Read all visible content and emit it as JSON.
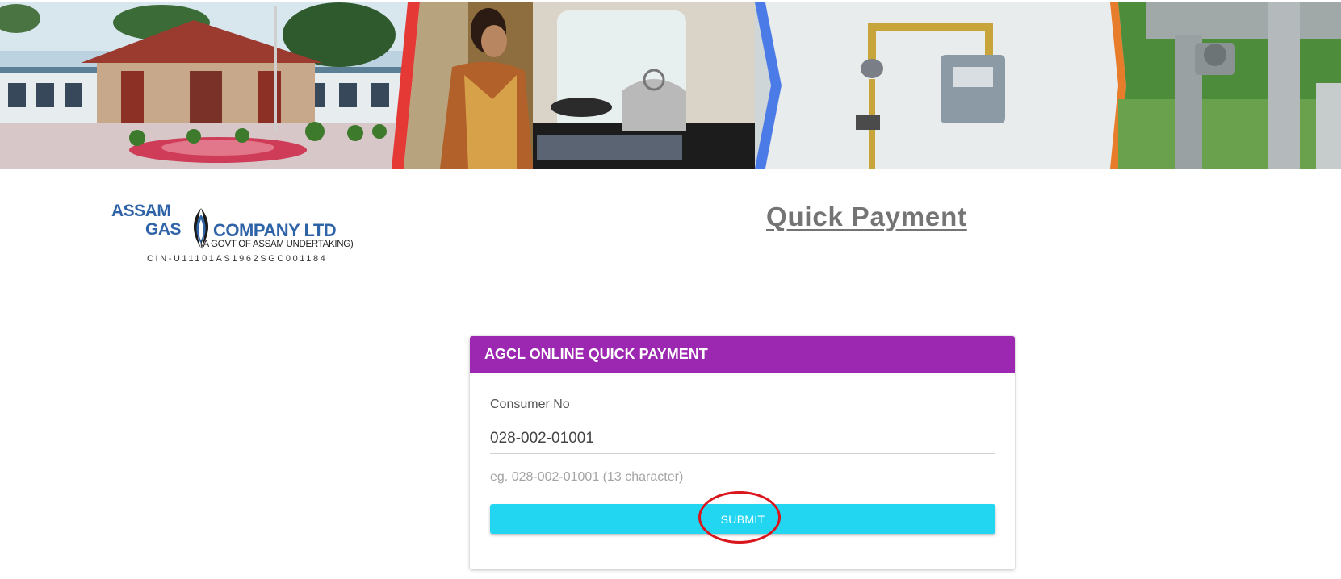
{
  "banner": {
    "panels": [
      "office-building-photo",
      "woman-cooking-on-gas-stove-photo",
      "gas-meter-pipe-photo",
      "gas-pipeline-valve-photo"
    ],
    "divider_colors": [
      "#e53935",
      "#4a7be6",
      "#e77c2a"
    ]
  },
  "logo": {
    "line1": "ASSAM",
    "line2": "GAS",
    "line3": "COMPANY LTD",
    "subtitle": "(A GOVT OF ASSAM UNDERTAKING)",
    "cin": "CIN-U11101AS1962SGC001184",
    "brand_color": "#2f63a8"
  },
  "page": {
    "title": "Quick Payment"
  },
  "form": {
    "header": "AGCL ONLINE QUICK PAYMENT",
    "header_color": "#9c27b0",
    "consumer_label": "Consumer No",
    "consumer_value": "028-002-01001",
    "hint": "eg. 028-002-01001 (13 character)",
    "submit_label": "SUBMIT",
    "submit_color": "#22d6f2"
  },
  "annotation": {
    "type": "red-circle-highlight",
    "color": "#d9161c",
    "target": "submit-button"
  }
}
